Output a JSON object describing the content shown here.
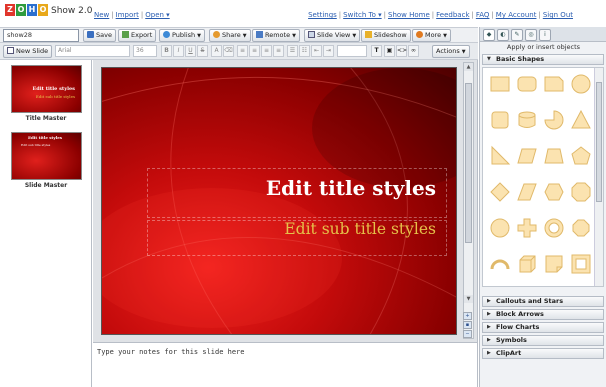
{
  "app": {
    "logo_letters": [
      "Z",
      "O",
      "H",
      "O"
    ],
    "logo_colors": [
      "#e0352b",
      "#2e9b3e",
      "#2a6fcf",
      "#e8a81a"
    ],
    "name": "Show 2.0"
  },
  "top_links_left": [
    "New",
    "Import",
    "Open"
  ],
  "top_links_right": [
    "Settings",
    "Switch To",
    "Show Home",
    "Feedback",
    "FAQ",
    "My Account",
    "Sign Out"
  ],
  "toolbar1": {
    "title_value": "show28",
    "save": "Save",
    "export": "Export",
    "publish": "Publish",
    "share": "Share",
    "remote": "Remote",
    "slide_view": "Slide View",
    "slideshow": "Slideshow",
    "more": "More"
  },
  "toolbar2": {
    "new_slide": "New Slide",
    "font_family": "Arial",
    "font_size": "36",
    "actions": "Actions"
  },
  "thumbnails": [
    {
      "caption": "Title Master",
      "title": "Edit title styles",
      "subtitle": "Edit sub title styles"
    },
    {
      "caption": "Slide Master",
      "title": "Edit title styles",
      "subtitle": "Edit sub title styles"
    }
  ],
  "slide": {
    "title": "Edit title styles",
    "subtitle": "Edit sub title styles",
    "title_color": "#ffffff",
    "subtitle_color": "#e5c14a"
  },
  "notes_placeholder": "Type your notes for this slide here",
  "right_panel": {
    "heading": "Apply or insert objects",
    "sections": [
      "Basic Shapes",
      "Callouts and Stars",
      "Block Arrows",
      "Flow Charts",
      "Symbols",
      "ClipArt"
    ],
    "shape_fill": "#fbe3b0",
    "shape_stroke": "#e0b96a",
    "shapes": [
      "rectangle",
      "rounded-rectangle",
      "snip-rectangle",
      "ellipse",
      "rounded-square",
      "can",
      "pie",
      "triangle",
      "right-triangle",
      "parallelogram",
      "trapezoid",
      "pentagon",
      "diamond",
      "parallelogram-slanted",
      "hexagon",
      "octagon",
      "circle",
      "plus",
      "donut",
      "octagon-small",
      "arc",
      "cube",
      "folded-corner",
      "frame"
    ]
  }
}
